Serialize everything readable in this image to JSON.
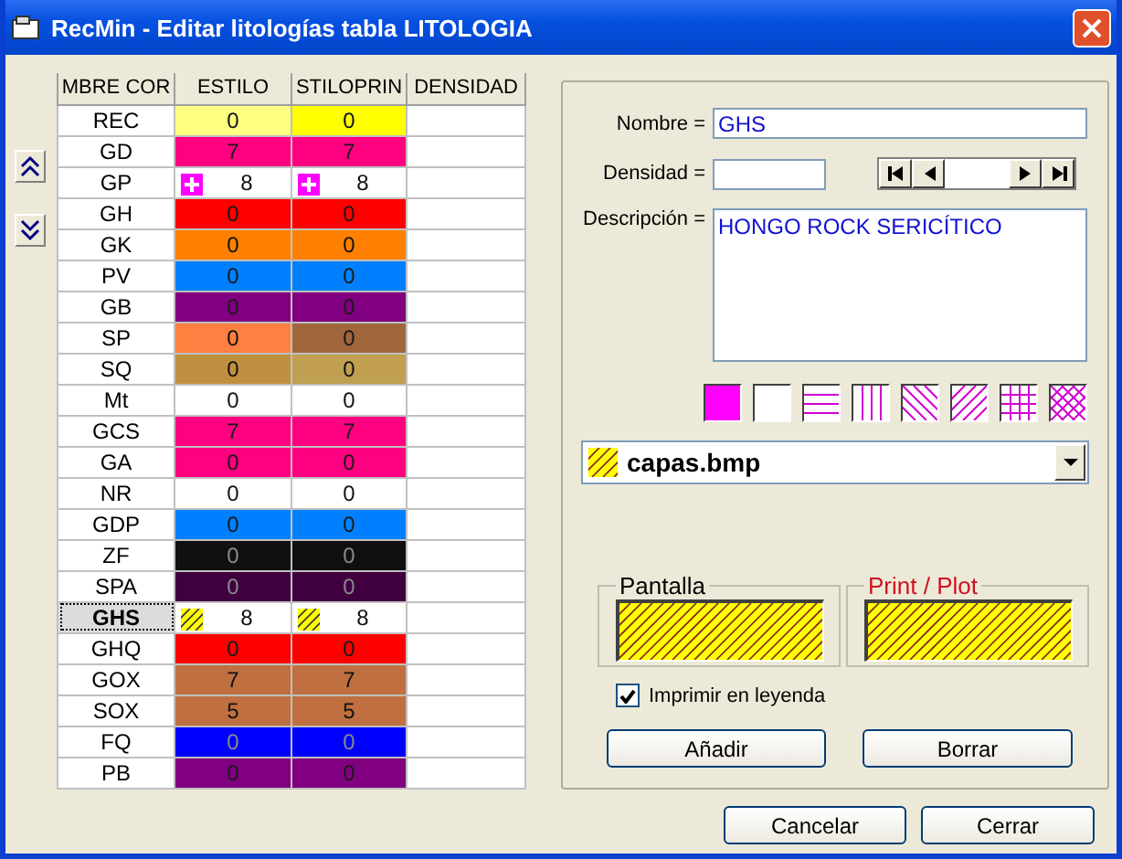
{
  "window": {
    "title": "RecMin - Editar litologías tabla LITOLOGIA"
  },
  "table": {
    "columns": [
      "MBRE COR",
      "ESTILO",
      "STILOPRIN",
      "DENSIDAD"
    ],
    "rows": [
      {
        "selected": false,
        "cells": [
          {
            "kind": "name",
            "value": "REC"
          },
          {
            "kind": "fill",
            "value": "0",
            "color": "#ffff80"
          },
          {
            "kind": "fill",
            "value": "0",
            "color": "#ffff00"
          }
        ]
      },
      {
        "selected": false,
        "cells": [
          {
            "kind": "name",
            "value": "GD"
          },
          {
            "kind": "fill",
            "value": "7",
            "color": "#ff0080"
          },
          {
            "kind": "fill",
            "value": "7",
            "color": "#ff0080"
          }
        ]
      },
      {
        "selected": false,
        "cells": [
          {
            "kind": "name",
            "value": "GP"
          },
          {
            "kind": "cross",
            "value": "8"
          },
          {
            "kind": "cross",
            "value": "8"
          }
        ]
      },
      {
        "selected": false,
        "cells": [
          {
            "kind": "name",
            "value": "GH"
          },
          {
            "kind": "fill",
            "value": "0",
            "color": "#ff0000"
          },
          {
            "kind": "fill",
            "value": "0",
            "color": "#ff0000"
          }
        ]
      },
      {
        "selected": false,
        "cells": [
          {
            "kind": "name",
            "value": "GK"
          },
          {
            "kind": "fill",
            "value": "0",
            "color": "#ff8000"
          },
          {
            "kind": "fill",
            "value": "0",
            "color": "#ff8000"
          }
        ]
      },
      {
        "selected": false,
        "cells": [
          {
            "kind": "name",
            "value": "PV"
          },
          {
            "kind": "fill",
            "value": "0",
            "color": "#0080ff"
          },
          {
            "kind": "fill",
            "value": "0",
            "color": "#0080ff"
          }
        ]
      },
      {
        "selected": false,
        "cells": [
          {
            "kind": "name",
            "value": "GB"
          },
          {
            "kind": "fill",
            "value": "0",
            "color": "#800080"
          },
          {
            "kind": "fill",
            "value": "0",
            "color": "#800080"
          }
        ]
      },
      {
        "selected": false,
        "cells": [
          {
            "kind": "name",
            "value": "SP"
          },
          {
            "kind": "fill",
            "value": "0",
            "color": "#ff8040"
          },
          {
            "kind": "fill",
            "value": "0",
            "color": "#a0663c"
          }
        ]
      },
      {
        "selected": false,
        "cells": [
          {
            "kind": "name",
            "value": "SQ"
          },
          {
            "kind": "fill",
            "value": "0",
            "color": "#c09040"
          },
          {
            "kind": "fill",
            "value": "0",
            "color": "#c0a050"
          }
        ]
      },
      {
        "selected": false,
        "cells": [
          {
            "kind": "name",
            "value": "Mt"
          },
          {
            "kind": "fill",
            "value": "0",
            "color": "#ffffff"
          },
          {
            "kind": "fill",
            "value": "0",
            "color": "#ffffff"
          }
        ]
      },
      {
        "selected": false,
        "cells": [
          {
            "kind": "name",
            "value": "GCS"
          },
          {
            "kind": "fill",
            "value": "7",
            "color": "#ff0080"
          },
          {
            "kind": "fill",
            "value": "7",
            "color": "#ff0080"
          }
        ]
      },
      {
        "selected": false,
        "cells": [
          {
            "kind": "name",
            "value": "GA"
          },
          {
            "kind": "fill",
            "value": "0",
            "color": "#ff0080"
          },
          {
            "kind": "fill",
            "value": "0",
            "color": "#ff0080"
          }
        ]
      },
      {
        "selected": false,
        "cells": [
          {
            "kind": "name",
            "value": "NR"
          },
          {
            "kind": "fill",
            "value": "0",
            "color": "#ffffff"
          },
          {
            "kind": "fill",
            "value": "0",
            "color": "#ffffff"
          }
        ]
      },
      {
        "selected": false,
        "cells": [
          {
            "kind": "name",
            "value": "GDP"
          },
          {
            "kind": "fill",
            "value": "0",
            "color": "#0080ff"
          },
          {
            "kind": "fill",
            "value": "0",
            "color": "#0080ff"
          }
        ]
      },
      {
        "selected": false,
        "cells": [
          {
            "kind": "name",
            "value": "ZF"
          },
          {
            "kind": "fill",
            "value": "0",
            "color": "#101010"
          },
          {
            "kind": "fill",
            "value": "0",
            "color": "#101010"
          }
        ]
      },
      {
        "selected": false,
        "cells": [
          {
            "kind": "name",
            "value": "SPA"
          },
          {
            "kind": "fill",
            "value": "0",
            "color": "#400040"
          },
          {
            "kind": "fill",
            "value": "0",
            "color": "#400040"
          }
        ]
      },
      {
        "selected": true,
        "cells": [
          {
            "kind": "name",
            "value": "GHS"
          },
          {
            "kind": "hatch",
            "value": "8"
          },
          {
            "kind": "hatch",
            "value": "8"
          }
        ]
      },
      {
        "selected": false,
        "cells": [
          {
            "kind": "name",
            "value": "GHQ"
          },
          {
            "kind": "fill",
            "value": "0",
            "color": "#ff0000"
          },
          {
            "kind": "fill",
            "value": "0",
            "color": "#ff0000"
          }
        ]
      },
      {
        "selected": false,
        "cells": [
          {
            "kind": "name",
            "value": "GOX"
          },
          {
            "kind": "fill",
            "value": "7",
            "color": "#c07040"
          },
          {
            "kind": "fill",
            "value": "7",
            "color": "#c07040"
          }
        ]
      },
      {
        "selected": false,
        "cells": [
          {
            "kind": "name",
            "value": "SOX"
          },
          {
            "kind": "fill",
            "value": "5",
            "color": "#c07040"
          },
          {
            "kind": "fill",
            "value": "5",
            "color": "#c07040"
          }
        ]
      },
      {
        "selected": false,
        "cells": [
          {
            "kind": "name",
            "value": "FQ"
          },
          {
            "kind": "fill",
            "value": "0",
            "color": "#0000ff"
          },
          {
            "kind": "fill",
            "value": "0",
            "color": "#0000ff"
          }
        ]
      },
      {
        "selected": false,
        "cells": [
          {
            "kind": "name",
            "value": "PB"
          },
          {
            "kind": "fill",
            "value": "0",
            "color": "#800080"
          },
          {
            "kind": "fill",
            "value": "0",
            "color": "#800080"
          }
        ]
      }
    ]
  },
  "form": {
    "nombre_label": "Nombre =",
    "nombre": "GHS",
    "densidad_label": "Densidad =",
    "descripcion_label": "Descripción =",
    "descripcion": "HONGO ROCK SERICÍTICO"
  },
  "pattern_swatches": [
    {
      "kind": "solid"
    },
    {
      "kind": "blank"
    },
    {
      "kind": "horizontal"
    },
    {
      "kind": "vertical"
    },
    {
      "kind": "backdiag"
    },
    {
      "kind": "diag"
    },
    {
      "kind": "grid"
    },
    {
      "kind": "crosshatch"
    }
  ],
  "pattern_select": {
    "value": "capas.bmp"
  },
  "previews": [
    {
      "label": "Pantalla",
      "kind": "screen"
    },
    {
      "label": "Print / Plot",
      "kind": "print"
    }
  ],
  "legend_checkbox": {
    "label": "Imprimir en leyenda",
    "checked": true
  },
  "panel_buttons": [
    "Añadir",
    "Borrar"
  ],
  "footer_buttons": [
    "Cancelar",
    "Cerrar"
  ]
}
